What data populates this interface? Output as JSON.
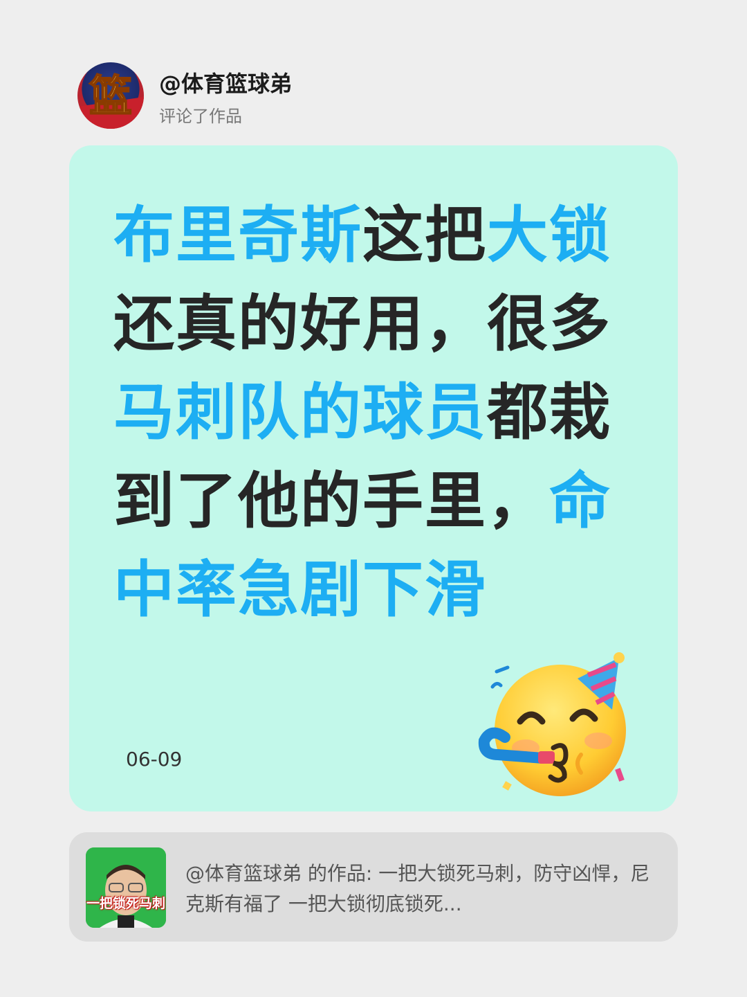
{
  "author": {
    "name": "@体育篮球弟",
    "action": "评论了作品",
    "avatar_glyph": "篮"
  },
  "comment": {
    "segments": [
      {
        "text": "布里奇斯",
        "highlight": true
      },
      {
        "text": "这把",
        "highlight": false
      },
      {
        "text": "大锁",
        "highlight": true
      },
      {
        "text": "还真的好用，很多",
        "highlight": false
      },
      {
        "text": "马刺队的球员",
        "highlight": true
      },
      {
        "text": "都栽到了他的手里，",
        "highlight": false
      },
      {
        "text": "命中率急剧下滑",
        "highlight": true
      }
    ],
    "date": "06-09",
    "emoji": "party-face-icon"
  },
  "referenced_work": {
    "thumbnail_caption": "一把锁死马刺",
    "description": "@体育篮球弟  的作品: 一把大锁死马刺，防守凶悍，尼克斯有福了 一把大锁彻底锁死..."
  },
  "colors": {
    "background": "#eeeeee",
    "card": "#c2f8ea",
    "highlight": "#1daef3",
    "text": "#262626",
    "ref_card": "#dddddd"
  }
}
